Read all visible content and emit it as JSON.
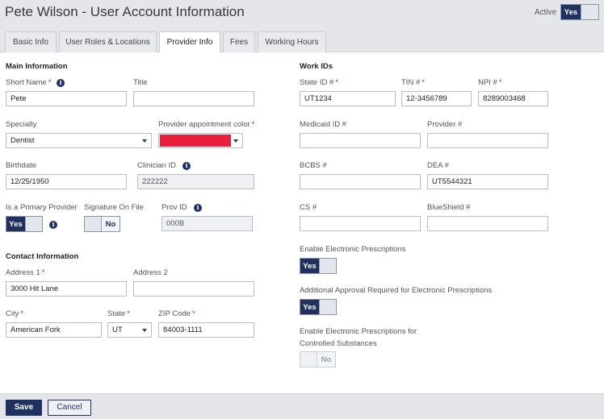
{
  "header": {
    "title": "Pete Wilson - User Account Information",
    "active_label": "Active",
    "active_toggle": "Yes"
  },
  "tabs": [
    {
      "label": "Basic Info"
    },
    {
      "label": "User Roles & Locations"
    },
    {
      "label": "Provider Info"
    },
    {
      "label": "Fees"
    },
    {
      "label": "Working Hours"
    }
  ],
  "main": {
    "section_title": "Main Information",
    "short_name": {
      "label": "Short Name",
      "value": "Pete"
    },
    "title": {
      "label": "Title",
      "value": ""
    },
    "specialty": {
      "label": "Specialty",
      "value": "Dentist"
    },
    "appointment_color": {
      "label": "Provider appointment color",
      "value": "#e8203c"
    },
    "birthdate": {
      "label": "Birthdate",
      "value": "12/25/1950"
    },
    "clinician_id": {
      "label": "Clinician ID",
      "value": "222222"
    },
    "primary_provider": {
      "label": "Is a Primary Provider",
      "value": "Yes"
    },
    "signature_on_file": {
      "label": "Signature On File",
      "value": "No"
    },
    "prov_id": {
      "label": "Prov ID",
      "value": "000B"
    }
  },
  "contact": {
    "section_title": "Contact Information",
    "address1": {
      "label": "Address 1",
      "value": "3000 Hit Lane"
    },
    "address2": {
      "label": "Address 2",
      "value": ""
    },
    "city": {
      "label": "City",
      "value": "American Fork"
    },
    "state": {
      "label": "State",
      "value": "UT"
    },
    "zip": {
      "label": "ZIP Code",
      "value": "84003-1111"
    }
  },
  "work_ids": {
    "section_title": "Work IDs",
    "state_id": {
      "label": "State ID #",
      "value": "UT1234"
    },
    "tin": {
      "label": "TIN #",
      "value": "12-3456789"
    },
    "npi": {
      "label": "NPI #",
      "value": "8289003468"
    },
    "medicaid_id": {
      "label": "Medicaid ID #",
      "value": ""
    },
    "provider_no": {
      "label": "Provider #",
      "value": ""
    },
    "bcbs": {
      "label": "BCBS #",
      "value": ""
    },
    "dea": {
      "label": "DEA #",
      "value": "UT5544321"
    },
    "cs": {
      "label": "CS #",
      "value": ""
    },
    "blueshield": {
      "label": "BlueShield #",
      "value": ""
    },
    "e_prescriptions": {
      "label": "Enable Electronic Prescriptions",
      "value": "Yes"
    },
    "additional_approval": {
      "label": "Additional Approval Required for Electronic Prescriptions",
      "value": "Yes"
    },
    "controlled_line1": "Enable Electronic Prescriptions for",
    "controlled_line2": "Controlled Substances",
    "controlled_value": "No"
  },
  "footer": {
    "save_label": "Save",
    "cancel_label": "Cancel"
  },
  "colors": {
    "primary": "#1e3160",
    "required": "#d9242a",
    "appointment_color": "#e8203c"
  },
  "icons": {
    "info": "info-icon",
    "dropdown": "chevron-down-icon"
  }
}
